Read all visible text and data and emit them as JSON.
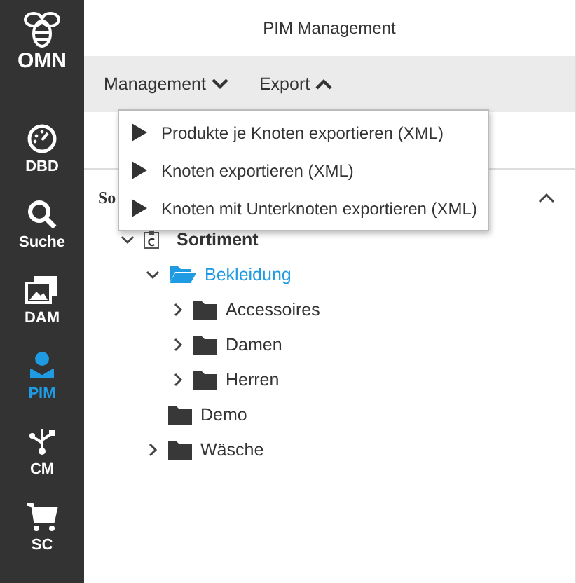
{
  "logo": {
    "text": "OMN"
  },
  "sidebar": {
    "items": [
      {
        "label": "DBD",
        "kind": "dashboard",
        "selected": false
      },
      {
        "label": "Suche",
        "kind": "search",
        "selected": false
      },
      {
        "label": "DAM",
        "kind": "images",
        "selected": false
      },
      {
        "label": "PIM",
        "kind": "pim",
        "selected": true
      },
      {
        "label": "CM",
        "kind": "network",
        "selected": false
      },
      {
        "label": "SC",
        "kind": "cart",
        "selected": false
      }
    ]
  },
  "header": {
    "title": "PIM Management"
  },
  "menu": [
    {
      "label": "Management",
      "open": false
    },
    {
      "label": "Export",
      "open": true
    }
  ],
  "dropdown": {
    "items": [
      {
        "label": "Produkte je Knoten exportieren (XML)"
      },
      {
        "label": "Knoten exportieren (XML)"
      },
      {
        "label": "Knoten mit Unterknoten exportieren (XML)"
      }
    ]
  },
  "panel": {
    "title": "So",
    "expanded": true
  },
  "tree": [
    {
      "label": "Sortiment",
      "kind": "catalog",
      "expandable": true,
      "expanded": true,
      "selected": false,
      "children": [
        {
          "label": "Bekleidung",
          "kind": "folder",
          "expandable": true,
          "expanded": true,
          "selected": true,
          "children": [
            {
              "label": "Accessoires",
              "kind": "folder",
              "expandable": true,
              "expanded": false,
              "selected": false
            },
            {
              "label": "Damen",
              "kind": "folder",
              "expandable": true,
              "expanded": false,
              "selected": false
            },
            {
              "label": "Herren",
              "kind": "folder",
              "expandable": true,
              "expanded": false,
              "selected": false
            }
          ]
        },
        {
          "label": "Demo",
          "kind": "folder",
          "expandable": false,
          "expanded": false,
          "selected": false
        },
        {
          "label": "Wäsche",
          "kind": "folder",
          "expandable": true,
          "expanded": false,
          "selected": false
        }
      ]
    }
  ]
}
